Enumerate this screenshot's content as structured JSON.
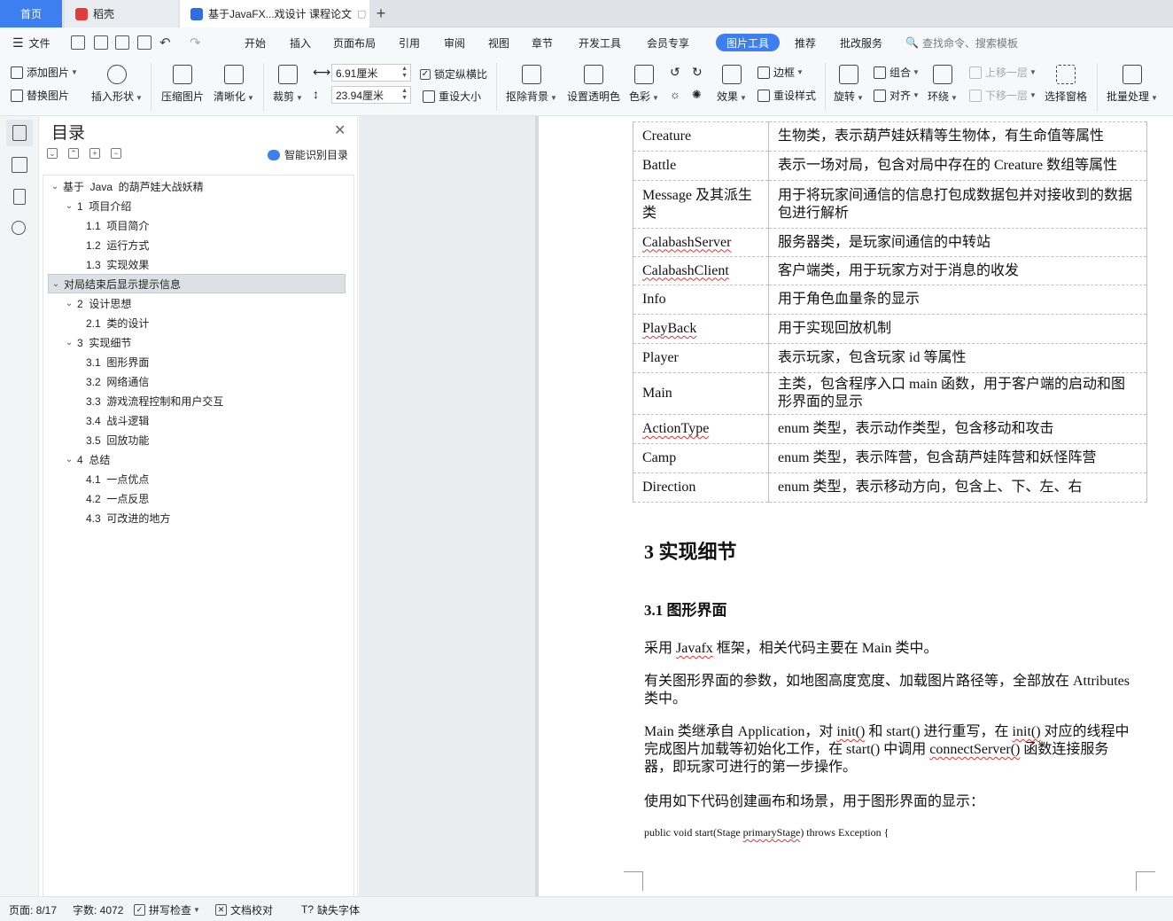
{
  "tabs": {
    "home": "首页",
    "docer": "稻壳",
    "doc": "基于JavaFX...戏设计 课程论文"
  },
  "menu": {
    "file": "文件",
    "items": [
      "开始",
      "插入",
      "页面布局",
      "引用",
      "审阅",
      "视图",
      "章节",
      "开发工具",
      "会员专享"
    ],
    "active": "图片工具",
    "after": [
      "推荐",
      "批改服务"
    ],
    "search": "查找命令、搜索模板"
  },
  "ribbon": {
    "add_image": "添加图片",
    "replace_image": "替换图片",
    "insert_shape": "插入形状",
    "compress": "压缩图片",
    "sharpen": "清晰化",
    "crop": "裁剪",
    "width": "6.91厘米",
    "height": "23.94厘米",
    "lock_ratio": "锁定纵横比",
    "reset_size": "重设大小",
    "remove_bg": "抠除背景",
    "set_transparent": "设置透明色",
    "color": "色彩",
    "effects": "效果",
    "border": "边框",
    "reset_style": "重设样式",
    "rotate": "旋转",
    "group": "组合",
    "align": "对齐",
    "wrap": "环绕",
    "bring_forward": "上移一层",
    "send_backward": "下移一层",
    "select_pane": "选择窗格",
    "batch": "批量处理"
  },
  "toc": {
    "title": "目录",
    "smart": "智能识别目录",
    "items": [
      {
        "text": "基于  Java  的葫芦娃大战妖精",
        "level": 0,
        "caret": true
      },
      {
        "text": "1  项目介绍",
        "level": 1,
        "caret": true
      },
      {
        "text": "1.1  项目简介",
        "level": 2,
        "caret": false
      },
      {
        "text": "1.2  运行方式",
        "level": 2,
        "caret": false
      },
      {
        "text": "1.3  实现效果",
        "level": 2,
        "caret": false
      },
      {
        "text": "对局结束后显示提示信息",
        "level": 0,
        "caret": true,
        "selected": true
      },
      {
        "text": "2  设计思想",
        "level": 1,
        "caret": true
      },
      {
        "text": "2.1  类的设计",
        "level": 2,
        "caret": false
      },
      {
        "text": "3  实现细节",
        "level": 1,
        "caret": true
      },
      {
        "text": "3.1  图形界面",
        "level": 2,
        "caret": false
      },
      {
        "text": "3.2  网络通信",
        "level": 2,
        "caret": false
      },
      {
        "text": "3.3  游戏流程控制和用户交互",
        "level": 2,
        "caret": false
      },
      {
        "text": "3.4  战斗逻辑",
        "level": 2,
        "caret": false
      },
      {
        "text": "3.5  回放功能",
        "level": 2,
        "caret": false
      },
      {
        "text": "4  总结",
        "level": 1,
        "caret": true
      },
      {
        "text": "4.1  一点优点",
        "level": 2,
        "caret": false
      },
      {
        "text": "4.2  一点反思",
        "level": 2,
        "caret": false
      },
      {
        "text": "4.3  可改进的地方",
        "level": 2,
        "caret": false
      }
    ]
  },
  "doc": {
    "table": [
      {
        "name": "Creature",
        "desc": "生物类，表示葫芦娃妖精等生物体，有生命值等属性",
        "wavy": false
      },
      {
        "name": "Battle",
        "desc": "表示一场对局，包含对局中存在的 Creature 数组等属性",
        "wavy": false
      },
      {
        "name": "Message 及其派生类",
        "desc": "用于将玩家间通信的信息打包成数据包并对接收到的数据包进行解析",
        "wavy": false
      },
      {
        "name": "CalabashServer",
        "desc": "服务器类，是玩家间通信的中转站",
        "wavy": true
      },
      {
        "name": "CalabashClient",
        "desc": "客户端类，用于玩家方对于消息的收发",
        "wavy": true
      },
      {
        "name": "Info",
        "desc": "用于角色血量条的显示",
        "wavy": false
      },
      {
        "name": "PlayBack",
        "desc": "用于实现回放机制",
        "wavy": true
      },
      {
        "name": "Player",
        "desc": "表示玩家，包含玩家  id  等属性",
        "wavy": false
      },
      {
        "name": "Main",
        "desc": "主类，包含程序入口  main  函数，用于客户端的启动和图形界面的显示",
        "wavy": false
      },
      {
        "name": "ActionType",
        "desc": "enum  类型，表示动作类型，包含移动和攻击",
        "wavy": true
      },
      {
        "name": "Camp",
        "desc": "enum  类型，表示阵营，包含葫芦娃阵营和妖怪阵营",
        "wavy": false
      },
      {
        "name": "Direction",
        "desc": "enum  类型，表示移动方向，包含上、下、左、右",
        "wavy": false
      }
    ],
    "h2": "3  实现细节",
    "h3": "3.1  图形界面",
    "p1": "采用  Javafx  框架，相关代码主要在 Main 类中。",
    "p2": "有关图形界面的参数，如地图高度宽度、加载图片路径等，全部放在 Attributes 类中。",
    "p3": "Main 类继承自 Application，对 init() 和 start() 进行重写，在 init() 对应的线程中完成图片加载等初始化工作，在 start() 中调用 connectServer() 函数连接服务器，即玩家可进行的第一步操作。",
    "p4": "使用如下代码创建画布和场景，用于图形界面的显示：",
    "code": "public void start(Stage primaryStage) throws Exception {"
  },
  "status": {
    "page": "页面: 8/17",
    "words": "字数: 4072",
    "spell": "拼写检查",
    "proof": "文档校对",
    "missing_font": "缺失字体"
  }
}
